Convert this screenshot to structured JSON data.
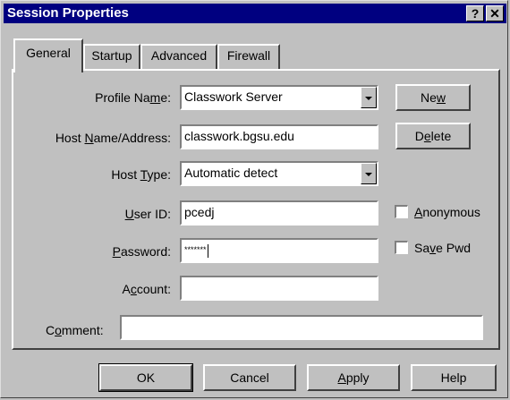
{
  "window": {
    "title": "Session Properties",
    "help_btn": "?",
    "close_btn": "✕"
  },
  "tabs": [
    {
      "label": "General",
      "active": true
    },
    {
      "label": "Startup",
      "active": false
    },
    {
      "label": "Advanced",
      "active": false
    },
    {
      "label": "Firewall",
      "active": false
    }
  ],
  "form": {
    "profile_name": {
      "label_pre": "Profile Na",
      "label_key": "m",
      "label_post": "e:",
      "value": "Classwork Server"
    },
    "host_name": {
      "label_pre": "Host ",
      "label_key": "N",
      "label_post": "ame/Address:",
      "value": "classwork.bgsu.edu"
    },
    "host_type": {
      "label_pre": "Host ",
      "label_key": "T",
      "label_post": "ype:",
      "value": "Automatic detect"
    },
    "user_id": {
      "label_pre": "",
      "label_key": "U",
      "label_post": "ser ID:",
      "value": "pcedj"
    },
    "password": {
      "label_pre": "",
      "label_key": "P",
      "label_post": "assword:",
      "value": "*******"
    },
    "account": {
      "label_pre": "A",
      "label_key": "c",
      "label_post": "count:",
      "value": ""
    },
    "comment": {
      "label_pre": "C",
      "label_key": "o",
      "label_post": "mment:",
      "value": ""
    }
  },
  "side_buttons": {
    "new": {
      "pre": "Ne",
      "key": "w",
      "post": ""
    },
    "delete": {
      "pre": "D",
      "key": "e",
      "post": "lete"
    }
  },
  "checkboxes": {
    "anonymous": {
      "pre": "",
      "key": "A",
      "post": "nonymous",
      "checked": false
    },
    "save_pwd": {
      "pre": "Sa",
      "key": "v",
      "post": "e Pwd",
      "checked": false
    }
  },
  "footer": {
    "ok": "OK",
    "cancel": "Cancel",
    "apply": {
      "pre": "",
      "key": "A",
      "post": "pply"
    },
    "help": "Help"
  }
}
